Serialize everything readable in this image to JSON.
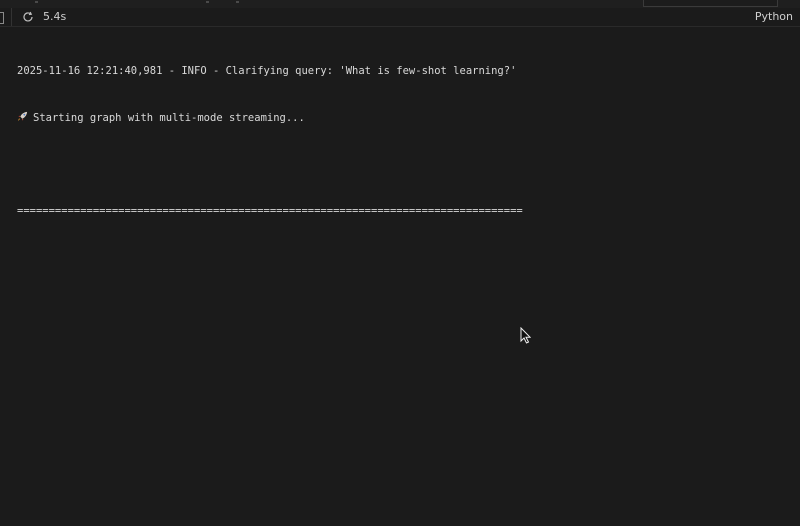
{
  "cell": {
    "exec_time": "5.4s",
    "language": "Python"
  },
  "output": {
    "lines": [
      "2025-11-16 12:21:40,981 - INFO - Clarifying query: 'What is few-shot learning?'",
      "Starting graph with multi-mode streaming..."
    ],
    "separator": "================================================================================"
  },
  "icons": {
    "refresh": "refresh-icon",
    "rocket": "rocket-icon",
    "pointer": "mouse-pointer-icon"
  },
  "colors": {
    "background": "#1b1b1b",
    "text": "#d9d9d9"
  }
}
